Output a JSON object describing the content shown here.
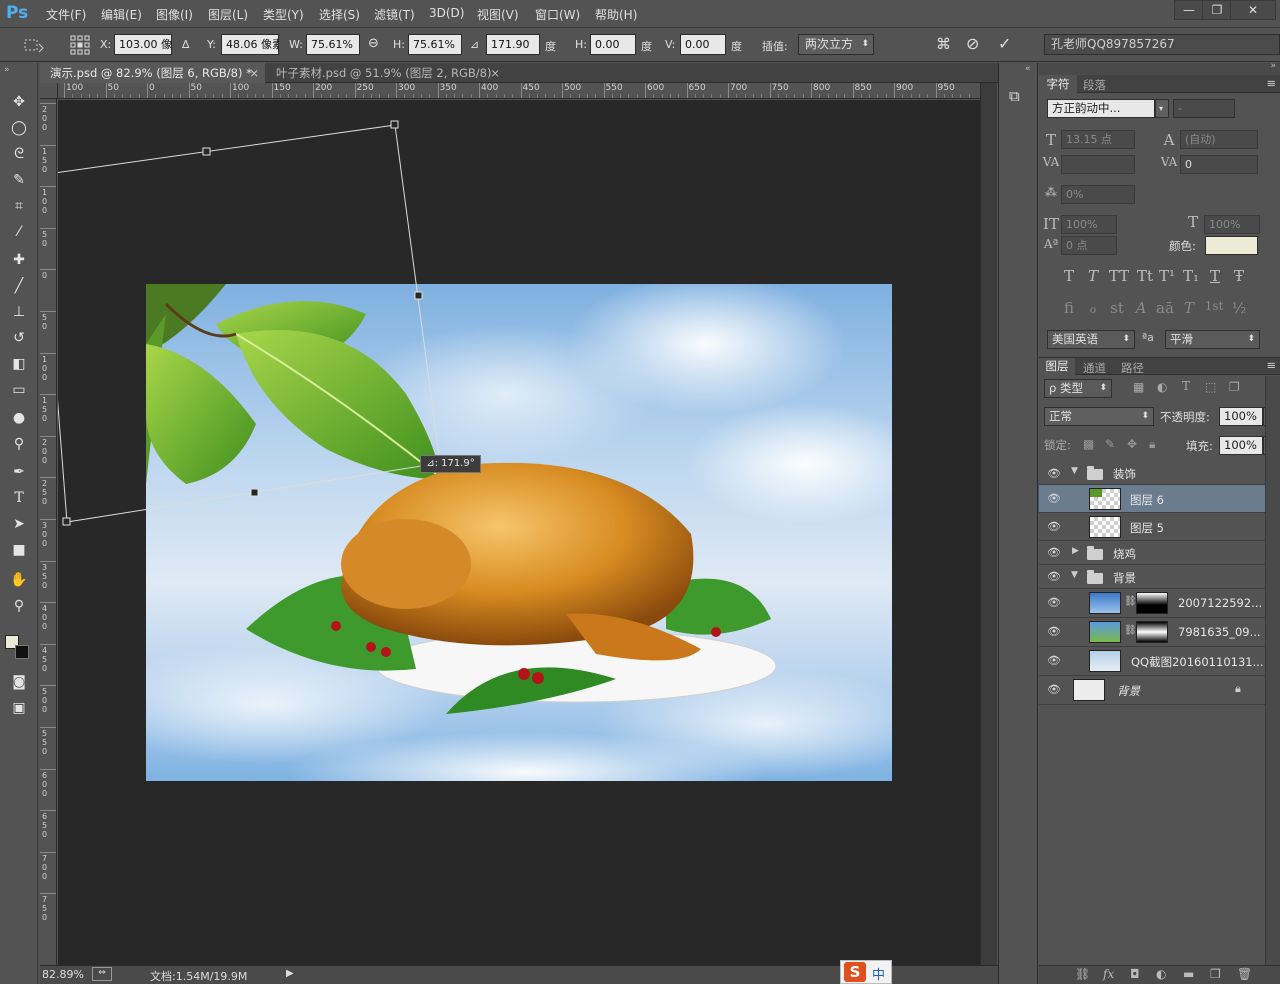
{
  "app": {
    "logo": "Ps"
  },
  "menu": [
    "文件(F)",
    "编辑(E)",
    "图像(I)",
    "图层(L)",
    "类型(Y)",
    "选择(S)",
    "滤镜(T)",
    "3D(D)",
    "视图(V)",
    "窗口(W)",
    "帮助(H)"
  ],
  "window_controls": {
    "minimize": "—",
    "restore": "❐",
    "close": "✕"
  },
  "options": {
    "x_label": "X:",
    "x_value": "103.00 像素",
    "y_label": "Y:",
    "y_value": "48.06 像素",
    "w_label": "W:",
    "w_value": "75.61%",
    "h_label": "H:",
    "h_value": "75.61%",
    "angle_value": "171.90",
    "angle_unit": "度",
    "hskew_label": "H:",
    "hskew_value": "0.00",
    "hskew_unit": "度",
    "vskew_label": "V:",
    "vskew_value": "0.00",
    "vskew_unit": "度",
    "interp_label": "插值:",
    "interp_value": "两次立方",
    "workspace_value": "孔老师QQ897857267"
  },
  "tabs": [
    {
      "label": "演示.psd @ 82.9% (图层 6, RGB/8) *",
      "close": "×",
      "active": true
    },
    {
      "label": "叶子素材.psd @ 51.9% (图层 2, RGB/8)",
      "close": "×",
      "active": false
    }
  ],
  "ruler_h": [
    "100",
    "50",
    "0",
    "50",
    "100",
    "150",
    "200",
    "250",
    "300",
    "350",
    "400",
    "450",
    "500",
    "550",
    "600",
    "650",
    "700",
    "750",
    "800",
    "850",
    "900",
    "950"
  ],
  "ruler_v": [
    "200",
    "150",
    "100",
    "50",
    "0",
    "50",
    "100",
    "150",
    "200",
    "250",
    "300",
    "350",
    "400",
    "450",
    "500",
    "550",
    "600",
    "650",
    "700",
    "750"
  ],
  "transform_readout": "⊿: 171.9°",
  "status": {
    "zoom": "82.89%",
    "doc": "文档:1.54M/19.9M"
  },
  "ime": {
    "brand": "S",
    "mode": "中"
  },
  "character_panel": {
    "tab_character": "字符",
    "tab_paragraph": "段落",
    "font_family": "方正韵动中...",
    "font_style": "-",
    "font_size": "13.15 点",
    "leading": "(自动)",
    "kerning": "",
    "tracking": "0",
    "tsume": "0%",
    "vscale": "100%",
    "hscale": "100%",
    "baseline": "0 点",
    "color_label": "颜色:",
    "color_swatch": "#ececd6",
    "style_buttons": [
      "T",
      "T",
      "TT",
      "Tt",
      "T¹",
      "T₁",
      "T",
      "Ŧ"
    ],
    "ot_buttons": [
      "fi",
      "ℴ",
      "st",
      "A",
      "aā",
      "T",
      "1st",
      "½"
    ],
    "language": "美国英语",
    "aa_label": "ªa",
    "antialias": "平滑"
  },
  "layers_panel": {
    "tab_layers": "图层",
    "tab_channels": "通道",
    "tab_paths": "路径",
    "filter_label": "ρ 类型",
    "blend_mode": "正常",
    "opacity_label": "不透明度:",
    "opacity_value": "100%",
    "lock_label": "锁定:",
    "fill_label": "填充:",
    "fill_value": "100%",
    "layers": [
      {
        "name": "装饰",
        "kind": "group-open"
      },
      {
        "name": "图层 6",
        "kind": "layer",
        "selected": true
      },
      {
        "name": "图层 5",
        "kind": "layer"
      },
      {
        "name": "烧鸡",
        "kind": "group-closed"
      },
      {
        "name": "背景",
        "kind": "group-open"
      },
      {
        "name": "2007122592...",
        "kind": "masked"
      },
      {
        "name": "7981635_09...",
        "kind": "masked"
      },
      {
        "name": "QQ截图20160110131...",
        "kind": "image"
      },
      {
        "name": "背景",
        "kind": "background"
      }
    ]
  }
}
